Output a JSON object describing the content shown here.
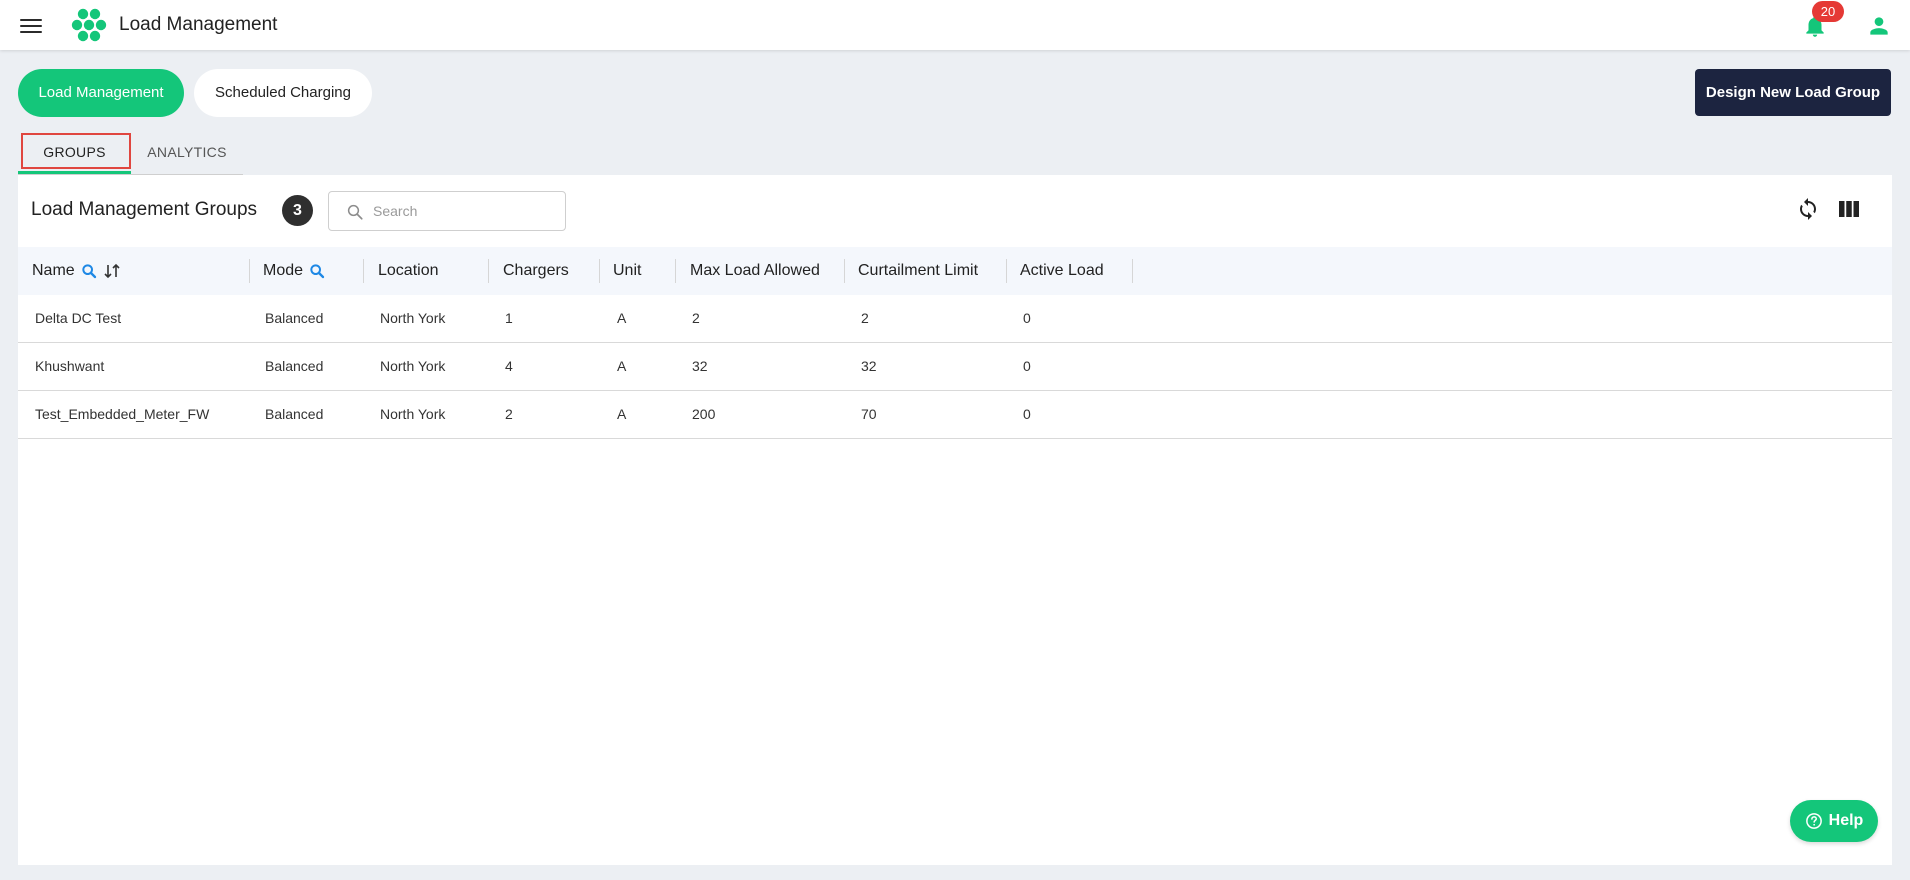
{
  "app": {
    "title": "Load Management"
  },
  "header": {
    "notification_count": "20"
  },
  "nav": {
    "pills": [
      "Load Management",
      "Scheduled Charging"
    ],
    "action_button": "Design New Load Group"
  },
  "tabs": [
    "GROUPS",
    "ANALYTICS"
  ],
  "card": {
    "title": "Load Management Groups",
    "count": "3",
    "search": {
      "placeholder": "Search",
      "value": ""
    }
  },
  "table": {
    "columns": [
      "Name",
      "Mode",
      "Location",
      "Chargers",
      "Unit",
      "Max Load Allowed",
      "Curtailment Limit",
      "Active Load"
    ],
    "rows": [
      [
        "Delta DC Test",
        "Balanced",
        "North York",
        "1",
        "A",
        "2",
        "2",
        "0"
      ],
      [
        "Khushwant",
        "Balanced",
        "North York",
        "4",
        "A",
        "32",
        "32",
        "0"
      ],
      [
        "Test_Embedded_Meter_FW",
        "Balanced",
        "North York",
        "2",
        "A",
        "200",
        "70",
        "0"
      ]
    ]
  },
  "help": {
    "label": "Help"
  },
  "colors": {
    "accent_green": "#14c67a",
    "dark_navy": "#1c2440",
    "badge_red": "#e53935",
    "tab_highlight_red": "#e0463f",
    "search_icon_blue": "#1e88e5"
  }
}
